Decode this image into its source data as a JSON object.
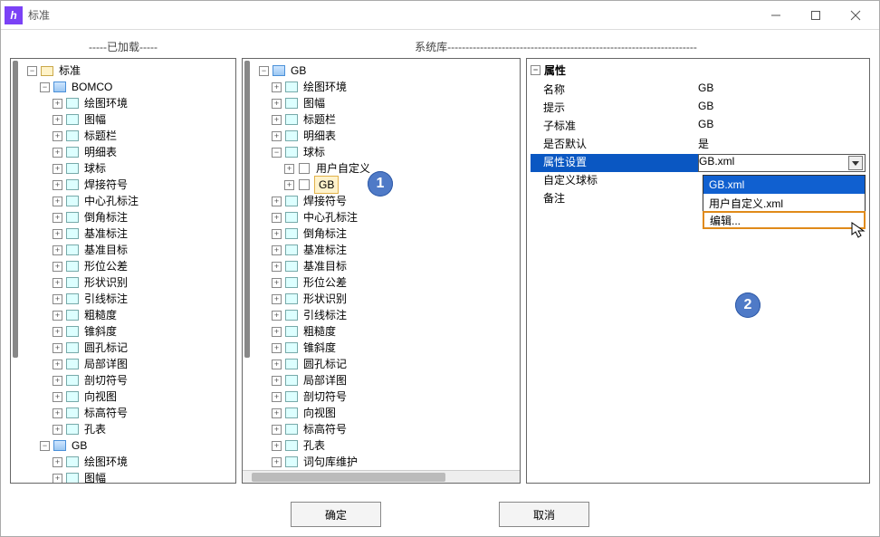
{
  "window": {
    "title": "标准"
  },
  "section_headers": {
    "left": "-----已加载-----",
    "right": "系统库---------------------------------------------------------------------"
  },
  "left_tree": {
    "root": "标准",
    "bomco": "BOMCO",
    "bomco_children": [
      "绘图环境",
      "图幅",
      "标题栏",
      "明细表",
      "球标",
      "焊接符号",
      "中心孔标注",
      "倒角标注",
      "基准标注",
      "基准目标",
      "形位公差",
      "形状识别",
      "引线标注",
      "粗糙度",
      "锥斜度",
      "圆孔标记",
      "局部详图",
      "剖切符号",
      "向视图",
      "标高符号",
      "孔表"
    ],
    "gb": "GB",
    "gb_children": [
      "绘图环境",
      "图幅"
    ]
  },
  "mid_tree": {
    "root": "GB",
    "children_before": [
      "绘图环境",
      "图幅",
      "标题栏",
      "明细表"
    ],
    "qiubiao": "球标",
    "qiubiao_children": [
      "用户自定义",
      "GB"
    ],
    "children_after": [
      "焊接符号",
      "中心孔标注",
      "倒角标注",
      "基准标注",
      "基准目标",
      "形位公差",
      "形状识别",
      "引线标注",
      "粗糙度",
      "锥斜度",
      "圆孔标记",
      "局部详图",
      "剖切符号",
      "向视图",
      "标高符号",
      "孔表",
      "词句库维护"
    ]
  },
  "props": {
    "header": "属性",
    "rows": [
      {
        "k": "名称",
        "v": "GB"
      },
      {
        "k": "提示",
        "v": "GB"
      },
      {
        "k": "子标准",
        "v": "GB"
      },
      {
        "k": "是否默认",
        "v": "是"
      },
      {
        "k": "属性设置",
        "v": "GB.xml",
        "selected": true
      },
      {
        "k": "自定义球标",
        "v": ""
      },
      {
        "k": "备注",
        "v": ""
      }
    ]
  },
  "combo": {
    "items": [
      "GB.xml",
      "用户自定义.xml",
      "编辑..."
    ],
    "highlight": 0,
    "edit_index": 2
  },
  "callouts": {
    "one": "1",
    "two": "2"
  },
  "buttons": {
    "ok": "确定",
    "cancel": "取消"
  }
}
